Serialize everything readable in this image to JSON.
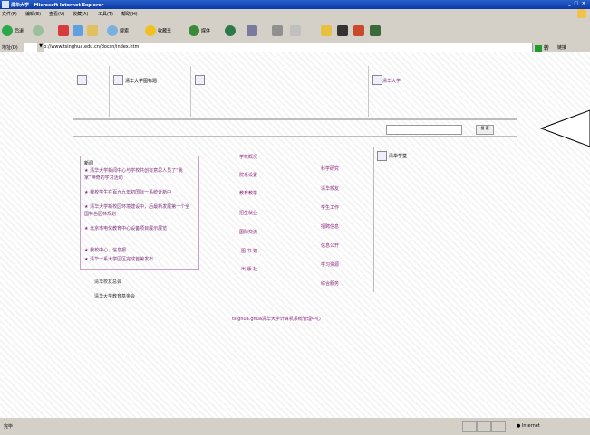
{
  "window": {
    "title": "清华大学 - Microsoft Internet Explorer",
    "controls": "_ □ ×"
  },
  "menu": [
    "文件(F)",
    "编辑(E)",
    "查看(V)",
    "收藏(A)",
    "工具(T)",
    "帮助(H)"
  ],
  "toolbar": {
    "back": "后退",
    "search": "搜索",
    "favorites": "收藏夹",
    "media": "媒体"
  },
  "address": {
    "label": "地址(D)",
    "url": "http://www.tsinghua.edu.cn/docsn/index.htm",
    "go": "转到",
    "links": "链接"
  },
  "banner": {
    "text1": "清华大学图标题",
    "text2": "清华大学"
  },
  "news": {
    "heading": "新闻",
    "items": [
      "清华大学新闻中心与学校共创有意思人员了“我家”神奇的学习活动",
      "我校学生在百九九年初国际一系统计新中",
      "清华大学新校园环境建设中，后最新发展第一个全国特色园林规划",
      "北京市电化教育中心设备项目展示展览",
      "我校中心，信息报",
      "清华一系大学园区完成首第发布"
    ]
  },
  "left_links": [
    "清华校友总会",
    "清华大学教育基金会"
  ],
  "nav_col1": [
    "学校概况",
    "院系设置",
    "教育教学",
    "招生就业",
    "国际交流",
    "图 书 馆",
    "出 版 社"
  ],
  "nav_col2": [
    "科学研究",
    "清华校友",
    "学生工作",
    "招聘信息",
    "信息公开",
    "学习资源",
    "综合服务"
  ],
  "right_panel": {
    "title": "清华学堂"
  },
  "search": {
    "button": "搜 索"
  },
  "footer": "ts.ghua.ghua清华大学计算机系统管理中心",
  "status": {
    "left": "完毕",
    "zone": "Internet"
  }
}
